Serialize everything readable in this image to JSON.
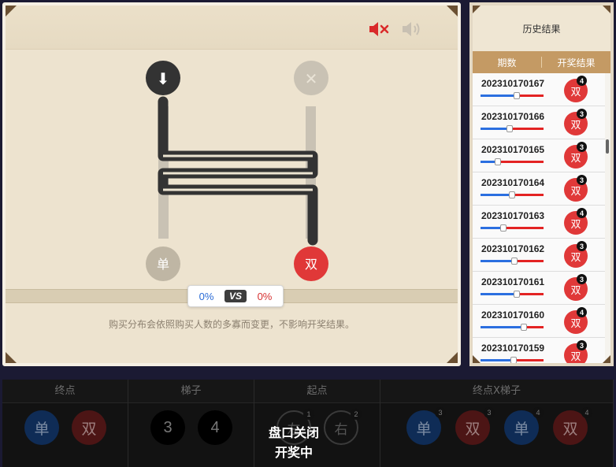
{
  "sound": {
    "mute_icon": "speaker-muted-icon",
    "volume_icon": "speaker-volume-icon"
  },
  "ladder": {
    "start_left_symbol": "⬇",
    "start_right_symbol": "✕",
    "end_left": "单",
    "end_right": "双",
    "colors": {
      "path": "#333333",
      "rail": "#c9c2b4",
      "odd": "#bfb6a4",
      "even": "#e03838"
    }
  },
  "vs": {
    "left_pct": "0%",
    "label": "VS",
    "right_pct": "0%"
  },
  "note": "购买分布会依照购买人数的多寡而变更，不影响开奖结果。",
  "history": {
    "title": "历史结果",
    "col_period": "期数",
    "col_result": "开奖结果",
    "rows": [
      {
        "period": "202310170167",
        "result": "双",
        "badge": "4",
        "ratio": 0.58
      },
      {
        "period": "202310170166",
        "result": "双",
        "badge": "3",
        "ratio": 0.46
      },
      {
        "period": "202310170165",
        "result": "双",
        "badge": "3",
        "ratio": 0.28
      },
      {
        "period": "202310170164",
        "result": "双",
        "badge": "3",
        "ratio": 0.5
      },
      {
        "period": "202310170163",
        "result": "双",
        "badge": "4",
        "ratio": 0.36
      },
      {
        "period": "202310170162",
        "result": "双",
        "badge": "3",
        "ratio": 0.54
      },
      {
        "period": "202310170161",
        "result": "双",
        "badge": "3",
        "ratio": 0.57
      },
      {
        "period": "202310170160",
        "result": "双",
        "badge": "4",
        "ratio": 0.69
      },
      {
        "period": "202310170159",
        "result": "双",
        "badge": "3",
        "ratio": 0.52
      }
    ]
  },
  "bet": {
    "cols": [
      {
        "title": "终点",
        "chips": [
          {
            "label": "单",
            "style": "blue"
          },
          {
            "label": "双",
            "style": "red"
          }
        ]
      },
      {
        "title": "梯子",
        "chips": [
          {
            "label": "3",
            "style": "black"
          },
          {
            "label": "4",
            "style": "black"
          }
        ]
      },
      {
        "title": "起点",
        "chips": [
          {
            "label": "左",
            "style": "outline",
            "num": "1"
          },
          {
            "label": "右",
            "style": "outline",
            "num": "2"
          }
        ]
      },
      {
        "title": "终点X梯子",
        "chips": [
          {
            "label": "单",
            "style": "blue",
            "num": "3"
          },
          {
            "label": "双",
            "style": "red",
            "num": "3"
          },
          {
            "label": "单",
            "style": "blue",
            "num": "4"
          },
          {
            "label": "双",
            "style": "red",
            "num": "4"
          }
        ]
      }
    ],
    "closed_line1": "盘口关闭",
    "closed_line2": "开奖中"
  }
}
